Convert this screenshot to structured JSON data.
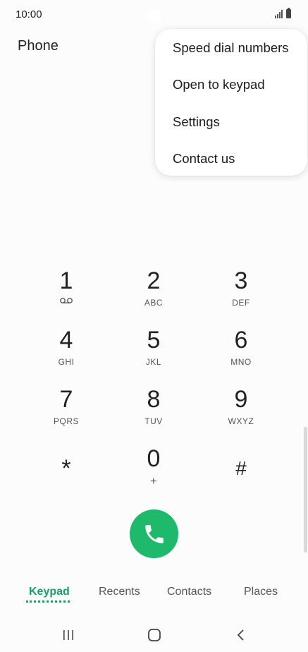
{
  "status": {
    "time": "10:00"
  },
  "app": {
    "title": "Phone"
  },
  "menu": {
    "items": [
      {
        "label": "Speed dial numbers"
      },
      {
        "label": "Open to keypad"
      },
      {
        "label": "Settings"
      },
      {
        "label": "Contact us"
      }
    ]
  },
  "keypad": {
    "keys": [
      {
        "digit": "1",
        "letters": "",
        "icon": "voicemail-icon"
      },
      {
        "digit": "2",
        "letters": "ABC"
      },
      {
        "digit": "3",
        "letters": "DEF"
      },
      {
        "digit": "4",
        "letters": "GHI"
      },
      {
        "digit": "5",
        "letters": "JKL"
      },
      {
        "digit": "6",
        "letters": "MNO"
      },
      {
        "digit": "7",
        "letters": "PQRS"
      },
      {
        "digit": "8",
        "letters": "TUV"
      },
      {
        "digit": "9",
        "letters": "WXYZ"
      },
      {
        "digit": "*",
        "letters": ""
      },
      {
        "digit": "0",
        "letters": "+"
      },
      {
        "digit": "#",
        "letters": ""
      }
    ]
  },
  "call": {
    "icon": "phone-icon",
    "color": "#1eb96b"
  },
  "tabs": [
    {
      "label": "Keypad",
      "active": true
    },
    {
      "label": "Recents"
    },
    {
      "label": "Contacts"
    },
    {
      "label": "Places"
    }
  ],
  "colors": {
    "accent": "#16a163",
    "call": "#1eb96b"
  },
  "navbar": {
    "icons": [
      "recents-icon",
      "home-icon",
      "back-icon"
    ]
  }
}
